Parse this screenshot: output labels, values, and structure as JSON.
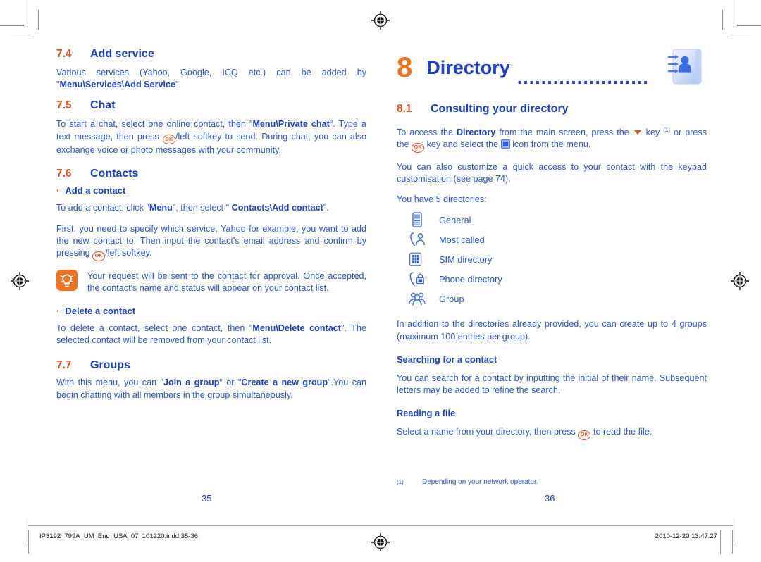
{
  "document": {
    "left_page": {
      "folio": "35",
      "sections": [
        {
          "number": "7.4",
          "title": "Add service",
          "paragraphs": [
            "Various services (Yahoo, Google, ICQ etc.) can be added by \"Menu\\Services\\Add Service\"."
          ]
        },
        {
          "number": "7.5",
          "title": "Chat",
          "paragraphs": [
            "To start a chat, select one online contact, then \"Menu\\Private chat\". Type a text message, then press (OK)/left softkey to send. During chat, you can also exchange voice or photo messages with your community."
          ]
        },
        {
          "number": "7.6",
          "title": "Contacts"
        },
        {
          "number": "7.7",
          "title": "Groups",
          "paragraphs": [
            "With this menu, you can \"Join a group\" or \"Create a new group\".You can begin chatting with all members in the group simultaneously."
          ]
        }
      ],
      "add_contact": {
        "bullet": "Add a contact",
        "para_1": "To add a contact, click \"Menu\", then select \" Contacts\\Add contact\".",
        "para_2": "First, you need to specify which service, Yahoo for example, you want to add the new contact to. Then input the contact's email address and confirm by pressing (OK)/left softkey."
      },
      "tip_note": "Your request will be sent to the contact for approval. Once accepted, the contact's name and status will appear on your contact list.",
      "delete_contact": {
        "bullet": "Delete a contact",
        "para": "To delete a contact, select one contact, then \"Menu\\Delete contact\". The selected contact will be removed from your contact list."
      }
    },
    "right_page": {
      "folio": "36",
      "chapter": {
        "number": "8",
        "title": "Directory",
        "leader": "......................",
        "icon": "address-book-icon"
      },
      "section": {
        "number": "8.1",
        "title": "Consulting your directory"
      },
      "para_access_pre": "To access the ",
      "para_access_bold": "Directory",
      "para_access_mid": " from the main screen, press the ",
      "para_access_key": "down-key",
      "para_access_post": " key ",
      "para_access_post2": " or press the ",
      "para_access_post3": " key and select the ",
      "para_access_post4": " icon from the menu.",
      "para_customize": "You can also customize a quick access to your contact with the keypad customisation (see page 74).",
      "directories_intro": "You have 5 directories:",
      "directories": [
        {
          "icon": "general-phonebook-icon",
          "label": "General"
        },
        {
          "icon": "most-called-icon",
          "label": "Most called"
        },
        {
          "icon": "sim-card-icon",
          "label": "SIM directory"
        },
        {
          "icon": "phone-lock-icon",
          "label": "Phone directory"
        },
        {
          "icon": "group-people-icon",
          "label": "Group"
        }
      ],
      "para_groups": "In addition to the directories already provided, you can create up to 4 groups (maximum 100 entries per group).",
      "searching": {
        "heading": "Searching for a contact",
        "para": "You can search for a contact by inputting the initial of their name. Subsequent letters may be added to refine the search."
      },
      "reading": {
        "heading": "Reading a file",
        "para_pre": "Select a name from your directory, then press ",
        "para_post": " to read the file."
      },
      "footnote": {
        "mark": "(1)",
        "text": "Depending on your network operator."
      }
    },
    "slug": {
      "filename": "IP3192_799A_UM_Eng_USA_07_101220.indd   35-36",
      "timestamp": "2010-12-20   13:47:27"
    },
    "glyphs": {
      "ok_key": "OK",
      "footnote_ref": "(1)",
      "bullet_dot": "·"
    },
    "colors": {
      "heading_blue": "#1D3FD1",
      "body_blue": "#2B56E0",
      "accent_orange": "#F04E23",
      "chapter_orange": "#F4721F",
      "tip_orange": "#F4721F"
    }
  }
}
